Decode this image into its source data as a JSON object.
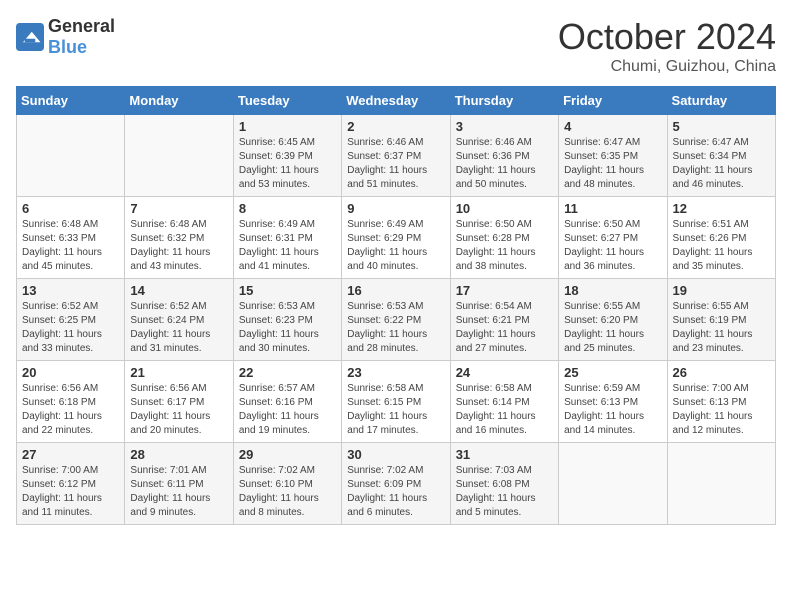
{
  "header": {
    "logo_general": "General",
    "logo_blue": "Blue",
    "month_title": "October 2024",
    "location": "Chumi, Guizhou, China"
  },
  "weekdays": [
    "Sunday",
    "Monday",
    "Tuesday",
    "Wednesday",
    "Thursday",
    "Friday",
    "Saturday"
  ],
  "weeks": [
    [
      {
        "day": "",
        "content": ""
      },
      {
        "day": "",
        "content": ""
      },
      {
        "day": "1",
        "content": "Sunrise: 6:45 AM\nSunset: 6:39 PM\nDaylight: 11 hours and 53 minutes."
      },
      {
        "day": "2",
        "content": "Sunrise: 6:46 AM\nSunset: 6:37 PM\nDaylight: 11 hours and 51 minutes."
      },
      {
        "day": "3",
        "content": "Sunrise: 6:46 AM\nSunset: 6:36 PM\nDaylight: 11 hours and 50 minutes."
      },
      {
        "day": "4",
        "content": "Sunrise: 6:47 AM\nSunset: 6:35 PM\nDaylight: 11 hours and 48 minutes."
      },
      {
        "day": "5",
        "content": "Sunrise: 6:47 AM\nSunset: 6:34 PM\nDaylight: 11 hours and 46 minutes."
      }
    ],
    [
      {
        "day": "6",
        "content": "Sunrise: 6:48 AM\nSunset: 6:33 PM\nDaylight: 11 hours and 45 minutes."
      },
      {
        "day": "7",
        "content": "Sunrise: 6:48 AM\nSunset: 6:32 PM\nDaylight: 11 hours and 43 minutes."
      },
      {
        "day": "8",
        "content": "Sunrise: 6:49 AM\nSunset: 6:31 PM\nDaylight: 11 hours and 41 minutes."
      },
      {
        "day": "9",
        "content": "Sunrise: 6:49 AM\nSunset: 6:29 PM\nDaylight: 11 hours and 40 minutes."
      },
      {
        "day": "10",
        "content": "Sunrise: 6:50 AM\nSunset: 6:28 PM\nDaylight: 11 hours and 38 minutes."
      },
      {
        "day": "11",
        "content": "Sunrise: 6:50 AM\nSunset: 6:27 PM\nDaylight: 11 hours and 36 minutes."
      },
      {
        "day": "12",
        "content": "Sunrise: 6:51 AM\nSunset: 6:26 PM\nDaylight: 11 hours and 35 minutes."
      }
    ],
    [
      {
        "day": "13",
        "content": "Sunrise: 6:52 AM\nSunset: 6:25 PM\nDaylight: 11 hours and 33 minutes."
      },
      {
        "day": "14",
        "content": "Sunrise: 6:52 AM\nSunset: 6:24 PM\nDaylight: 11 hours and 31 minutes."
      },
      {
        "day": "15",
        "content": "Sunrise: 6:53 AM\nSunset: 6:23 PM\nDaylight: 11 hours and 30 minutes."
      },
      {
        "day": "16",
        "content": "Sunrise: 6:53 AM\nSunset: 6:22 PM\nDaylight: 11 hours and 28 minutes."
      },
      {
        "day": "17",
        "content": "Sunrise: 6:54 AM\nSunset: 6:21 PM\nDaylight: 11 hours and 27 minutes."
      },
      {
        "day": "18",
        "content": "Sunrise: 6:55 AM\nSunset: 6:20 PM\nDaylight: 11 hours and 25 minutes."
      },
      {
        "day": "19",
        "content": "Sunrise: 6:55 AM\nSunset: 6:19 PM\nDaylight: 11 hours and 23 minutes."
      }
    ],
    [
      {
        "day": "20",
        "content": "Sunrise: 6:56 AM\nSunset: 6:18 PM\nDaylight: 11 hours and 22 minutes."
      },
      {
        "day": "21",
        "content": "Sunrise: 6:56 AM\nSunset: 6:17 PM\nDaylight: 11 hours and 20 minutes."
      },
      {
        "day": "22",
        "content": "Sunrise: 6:57 AM\nSunset: 6:16 PM\nDaylight: 11 hours and 19 minutes."
      },
      {
        "day": "23",
        "content": "Sunrise: 6:58 AM\nSunset: 6:15 PM\nDaylight: 11 hours and 17 minutes."
      },
      {
        "day": "24",
        "content": "Sunrise: 6:58 AM\nSunset: 6:14 PM\nDaylight: 11 hours and 16 minutes."
      },
      {
        "day": "25",
        "content": "Sunrise: 6:59 AM\nSunset: 6:13 PM\nDaylight: 11 hours and 14 minutes."
      },
      {
        "day": "26",
        "content": "Sunrise: 7:00 AM\nSunset: 6:13 PM\nDaylight: 11 hours and 12 minutes."
      }
    ],
    [
      {
        "day": "27",
        "content": "Sunrise: 7:00 AM\nSunset: 6:12 PM\nDaylight: 11 hours and 11 minutes."
      },
      {
        "day": "28",
        "content": "Sunrise: 7:01 AM\nSunset: 6:11 PM\nDaylight: 11 hours and 9 minutes."
      },
      {
        "day": "29",
        "content": "Sunrise: 7:02 AM\nSunset: 6:10 PM\nDaylight: 11 hours and 8 minutes."
      },
      {
        "day": "30",
        "content": "Sunrise: 7:02 AM\nSunset: 6:09 PM\nDaylight: 11 hours and 6 minutes."
      },
      {
        "day": "31",
        "content": "Sunrise: 7:03 AM\nSunset: 6:08 PM\nDaylight: 11 hours and 5 minutes."
      },
      {
        "day": "",
        "content": ""
      },
      {
        "day": "",
        "content": ""
      }
    ]
  ]
}
